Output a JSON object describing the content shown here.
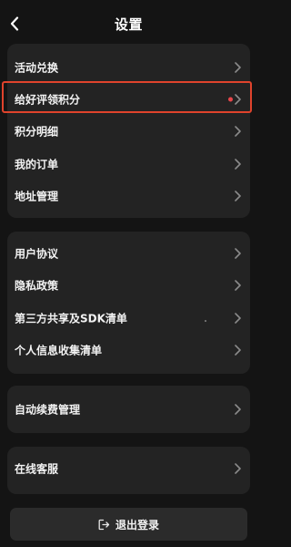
{
  "header": {
    "title": "设置",
    "back_icon": "chevron-left-icon"
  },
  "groups": [
    {
      "items": [
        {
          "label": "活动兑换"
        },
        {
          "label": "给好评领积分",
          "badge": "red-dot",
          "highlighted": true
        },
        {
          "label": "积分明细"
        },
        {
          "label": "我的订单"
        },
        {
          "label": "地址管理"
        }
      ]
    },
    {
      "items": [
        {
          "label": "用户协议"
        },
        {
          "label": "隐私政策"
        },
        {
          "label": "第三方共享及SDK清单"
        },
        {
          "label": "个人信息收集清单"
        }
      ]
    },
    {
      "items": [
        {
          "label": "自动续费管理"
        }
      ]
    },
    {
      "items": [
        {
          "label": "在线客服"
        }
      ]
    }
  ],
  "logout": {
    "label": "退出登录",
    "icon": "logout-icon"
  },
  "colors": {
    "background": "#141414",
    "card": "#232323",
    "highlight_border": "#e0432c",
    "badge_dot": "#e8464a"
  }
}
